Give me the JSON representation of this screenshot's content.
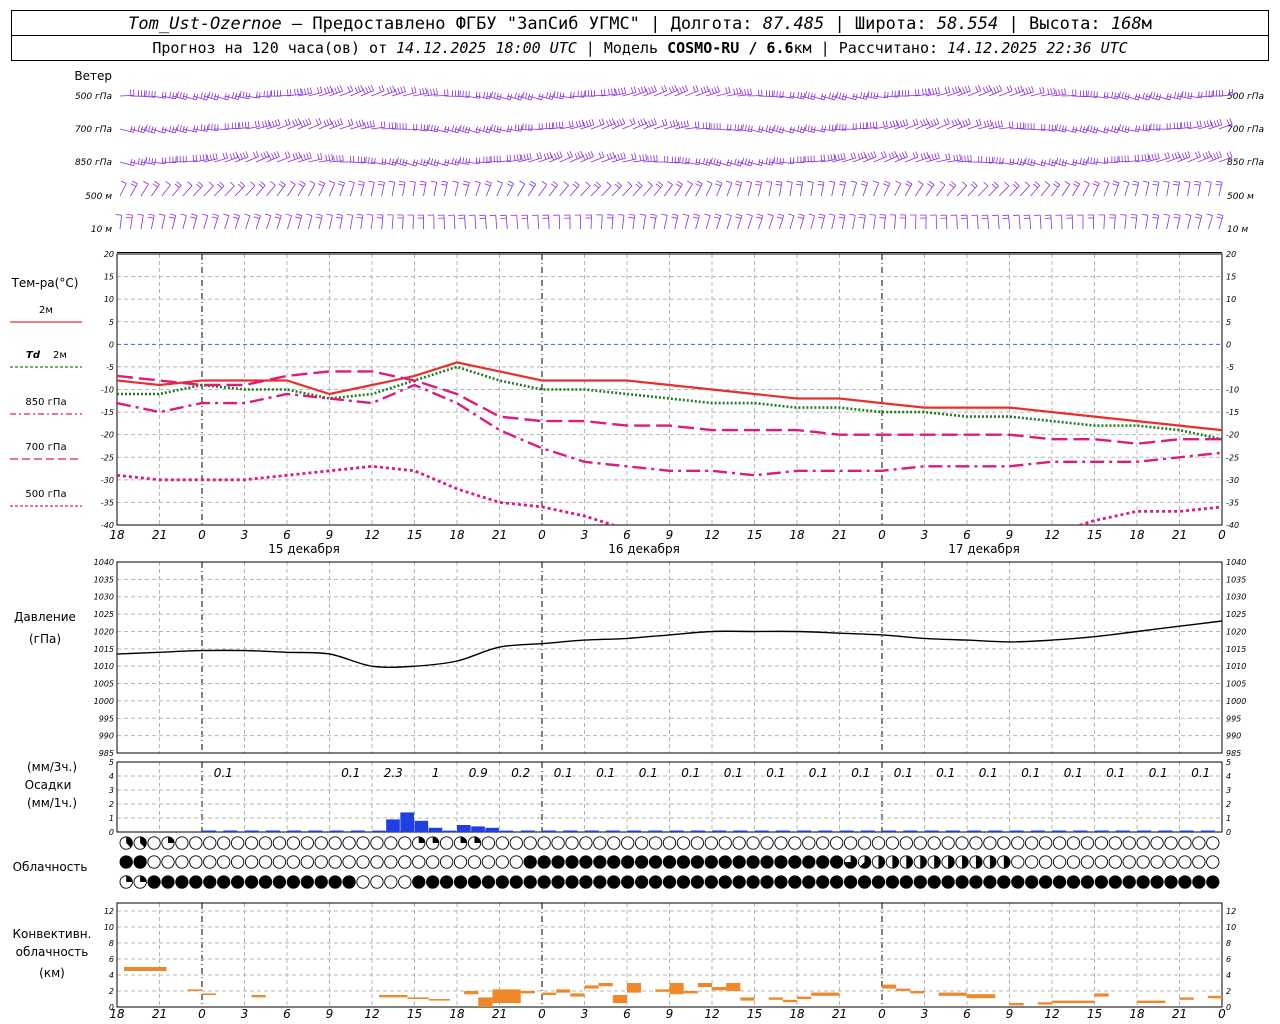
{
  "header": {
    "station": "Tom_Ust-Ozernoe",
    "provider": "Предоставлено ФГБУ \"ЗапСиб УГМС\"",
    "lon_label": "Долгота:",
    "lon": "87.485",
    "lat_label": "Широта:",
    "lat": "58.554",
    "alt_label": "Высота:",
    "alt": "168",
    "alt_unit": "м",
    "forecast_label": "Прогноз на 120 часа(ов) от",
    "forecast_from": "14.12.2025 18:00 UTC",
    "model_label": "Модель",
    "model": "COSMO-RU / 6.6",
    "model_unit": "км",
    "computed_label": "Рассчитано:",
    "computed": "14.12.2025 22:36 UTC"
  },
  "time_axis": {
    "hour_labels": [
      "18",
      "21",
      "0",
      "3",
      "6",
      "9",
      "12",
      "15",
      "18",
      "21",
      "0",
      "3",
      "6",
      "9",
      "12",
      "15",
      "18",
      "21",
      "0",
      "3",
      "6",
      "9",
      "12",
      "15",
      "18",
      "21",
      "0"
    ],
    "day_labels": [
      {
        "text": "15 декабря",
        "at_hour": 12
      },
      {
        "text": "16 декабря",
        "at_hour": 36
      },
      {
        "text": "17 декабря",
        "at_hour": 60
      }
    ],
    "midnights": [
      6,
      30,
      54,
      78
    ]
  },
  "wind_panel": {
    "title": "Ветер",
    "levels": [
      "500 гПа",
      "700 гПа",
      "850 гПа",
      "500 м",
      "10 м"
    ],
    "colors": {
      "barbs": "#8a2be2"
    }
  },
  "temp_panel": {
    "title": "Тем-ра(°С)",
    "legend": [
      {
        "label": "2м",
        "color": "#e8302a",
        "style": "solid"
      },
      {
        "label": "Td",
        "label2": "2м",
        "color": "#1e7d1e",
        "style": "dotted"
      },
      {
        "label": "850 гПа",
        "color": "#e0197d",
        "style": "dashdot"
      },
      {
        "label": "700 гПа",
        "color": "#e0197d",
        "style": "dash"
      },
      {
        "label": "500 гПа",
        "color": "#e0197d",
        "style": "dot"
      }
    ],
    "ticks": [
      "20",
      "15",
      "10",
      "5",
      "0",
      "-5",
      "-10",
      "-15",
      "-20",
      "-25",
      "-30",
      "-35",
      "-40"
    ]
  },
  "pressure_panel": {
    "title": "Давление",
    "unit": "(гПа)",
    "ticks": [
      "1040",
      "1035",
      "1030",
      "1025",
      "1020",
      "1015",
      "1010",
      "1005",
      "1000",
      "995",
      "990",
      "985"
    ]
  },
  "precip_panel": {
    "unit3h": "(мм/3ч.)",
    "title": "Осадки",
    "unit1h": "(мм/1ч.)",
    "ticks": [
      "5",
      "4",
      "3",
      "2",
      "1",
      "0"
    ],
    "amounts": [
      {
        "text": "0.1",
        "at_hour": 7.5
      },
      {
        "text": "0.1",
        "at_hour": 16.5
      },
      {
        "text": "2.3",
        "at_hour": 19.5
      },
      {
        "text": "1",
        "at_hour": 22.5
      },
      {
        "text": "0.9",
        "at_hour": 25.5
      },
      {
        "text": "0.2",
        "at_hour": 28.5
      },
      {
        "text": "0.1",
        "at_hour": 31.5
      },
      {
        "text": "0.1",
        "at_hour": 34.5
      },
      {
        "text": "0.1",
        "at_hour": 37.5
      },
      {
        "text": "0.1",
        "at_hour": 40.5
      },
      {
        "text": "0.1",
        "at_hour": 43.5
      },
      {
        "text": "0.1",
        "at_hour": 46.5
      },
      {
        "text": "0.1",
        "at_hour": 49.5
      },
      {
        "text": "0.1",
        "at_hour": 52.5
      },
      {
        "text": "0.1",
        "at_hour": 55.5
      },
      {
        "text": "0.1",
        "at_hour": 58.5
      },
      {
        "text": "0.1",
        "at_hour": 61.5
      },
      {
        "text": "0.1",
        "at_hour": 64.5
      },
      {
        "text": "0.1",
        "at_hour": 67.5
      },
      {
        "text": "0.1",
        "at_hour": 70.5
      },
      {
        "text": "0.1",
        "at_hour": 73.5
      },
      {
        "text": "0.1",
        "at_hour": 76.5
      }
    ],
    "colors": {
      "bars": "#1f3fe0"
    }
  },
  "cloud_panel": {
    "title": "Облачность",
    "rows": {
      "upper": "33302000200000000000008000000000220002200000000000000000000000000000000000000000000000000000000000000000000000000000000000",
      "middle": "88800000000000000000000000000000000000000000088888888888888888888888888888888888886544444444444444444000000000000000000000000",
      "lower": "222888888888888888888888888000000888888888888888888888888888888888888888888888888888888888888888888888888888888888888888888888"
    }
  },
  "conv_panel": {
    "title1": "Конвективн.",
    "title2": "облачность",
    "unit": "(км)",
    "ticks": [
      "12",
      "10",
      "8",
      "6",
      "4",
      "2",
      "0"
    ],
    "colors": {
      "bars": "#f0882a"
    }
  },
  "chart_data": [
    {
      "type": "line",
      "title": "Тем-ра(°С)",
      "x_unit": "hours since 14.12.2025 18:00 UTC",
      "ylim": [
        -40,
        20
      ],
      "series": [
        {
          "name": "2м",
          "x": [
            0,
            3,
            6,
            9,
            12,
            15,
            18,
            21,
            24,
            27,
            30,
            33,
            36,
            39,
            42,
            45,
            48,
            51,
            54,
            57,
            60,
            63,
            66,
            69,
            72,
            75,
            78
          ],
          "y": [
            -8,
            -9,
            -8,
            -8,
            -8,
            -11,
            -9,
            -7,
            -4,
            -6,
            -8,
            -8,
            -8,
            -9,
            -10,
            -11,
            -12,
            -12,
            -13,
            -14,
            -14,
            -14,
            -15,
            -16,
            -17,
            -18,
            -19
          ]
        },
        {
          "name": "Td 2м",
          "x": [
            0,
            3,
            6,
            9,
            12,
            15,
            18,
            21,
            24,
            27,
            30,
            33,
            36,
            39,
            42,
            45,
            48,
            51,
            54,
            57,
            60,
            63,
            66,
            69,
            72,
            75,
            78
          ],
          "y": [
            -11,
            -11,
            -9,
            -10,
            -10,
            -12,
            -11,
            -8,
            -5,
            -8,
            -10,
            -10,
            -11,
            -12,
            -13,
            -13,
            -14,
            -14,
            -15,
            -15,
            -16,
            -16,
            -17,
            -18,
            -18,
            -19,
            -21
          ]
        },
        {
          "name": "850 гПа",
          "x": [
            0,
            3,
            6,
            9,
            12,
            15,
            18,
            21,
            24,
            27,
            30,
            33,
            36,
            39,
            42,
            45,
            48,
            51,
            54,
            57,
            60,
            63,
            66,
            69,
            72,
            75,
            78
          ],
          "y": [
            -13,
            -15,
            -13,
            -13,
            -11,
            -12,
            -13,
            -9,
            -13,
            -19,
            -23,
            -26,
            -27,
            -28,
            -28,
            -29,
            -28,
            -28,
            -28,
            -27,
            -27,
            -27,
            -26,
            -26,
            -26,
            -25,
            -24
          ]
        },
        {
          "name": "700 гПа",
          "x": [
            0,
            3,
            6,
            9,
            12,
            15,
            18,
            21,
            24,
            27,
            30,
            33,
            36,
            39,
            42,
            45,
            48,
            51,
            54,
            57,
            60,
            63,
            66,
            69,
            72,
            75,
            78
          ],
          "y": [
            -7,
            -8,
            -9,
            -9,
            -7,
            -6,
            -6,
            -8,
            -11,
            -16,
            -17,
            -17,
            -18,
            -18,
            -19,
            -19,
            -19,
            -20,
            -20,
            -20,
            -20,
            -20,
            -21,
            -21,
            -22,
            -21,
            -21
          ]
        },
        {
          "name": "500 гПа",
          "x": [
            0,
            3,
            6,
            9,
            12,
            15,
            18,
            21,
            24,
            27,
            30,
            33,
            36,
            39,
            42,
            45,
            48,
            51,
            54,
            57,
            60,
            63,
            66,
            69,
            72,
            75,
            78
          ],
          "y": [
            -29,
            -30,
            -30,
            -30,
            -29,
            -28,
            -27,
            -28,
            -32,
            -35,
            -36,
            -38,
            -41,
            -43,
            -45,
            -46,
            -46,
            -46,
            -46,
            -46,
            -45,
            -44,
            -42,
            -39,
            -37,
            -37,
            -36
          ]
        }
      ]
    },
    {
      "type": "line",
      "title": "Давление",
      "ylabel": "(гПа)",
      "x_unit": "hours since 14.12.2025 18:00 UTC",
      "ylim": [
        985,
        1040
      ],
      "series": [
        {
          "name": "Давление",
          "x": [
            0,
            3,
            6,
            9,
            12,
            15,
            18,
            21,
            24,
            27,
            30,
            33,
            36,
            39,
            42,
            45,
            48,
            51,
            54,
            57,
            60,
            63,
            66,
            69,
            72,
            75,
            78
          ],
          "y": [
            1013.5,
            1014,
            1014.5,
            1014.5,
            1014,
            1013.5,
            1010,
            1010,
            1011.5,
            1015.5,
            1016.5,
            1017.5,
            1018,
            1019,
            1020,
            1020,
            1020,
            1019.5,
            1019,
            1018,
            1017.5,
            1017,
            1017.5,
            1018.5,
            1020,
            1021.5,
            1023
          ]
        }
      ]
    },
    {
      "type": "bar",
      "title": "Осадки",
      "ylabel": "(мм/1ч.)",
      "x_unit": "hours since 14.12.2025 18:00 UTC",
      "ylim": [
        0,
        5
      ],
      "x": [
        18,
        19,
        20,
        21,
        22,
        23,
        24,
        25,
        26,
        27
      ],
      "values": [
        0.1,
        0.9,
        1.4,
        0.8,
        0.3,
        0.1,
        0.5,
        0.4,
        0.3,
        0.1
      ]
    },
    {
      "type": "bar",
      "title": "Конвективн. облачность",
      "ylabel": "(км)",
      "x_unit": "hours since 14.12.2025 18:00 UTC",
      "ylim": [
        0,
        13
      ],
      "bars": [
        {
          "x0": 0.5,
          "x1": 3.5,
          "top": 5,
          "base": 4.5
        },
        {
          "x0": 5,
          "x1": 6,
          "top": 2.2,
          "base": 2
        },
        {
          "x0": 6,
          "x1": 7,
          "top": 1.7,
          "base": 1.5
        },
        {
          "x0": 9.5,
          "x1": 10.5,
          "top": 1.5,
          "base": 1.2
        },
        {
          "x0": 18.5,
          "x1": 20.5,
          "top": 1.5,
          "base": 1.2
        },
        {
          "x0": 20.5,
          "x1": 22,
          "top": 1.2,
          "base": 1
        },
        {
          "x0": 22,
          "x1": 23.5,
          "top": 1,
          "base": 0.8
        },
        {
          "x0": 24.5,
          "x1": 25.5,
          "top": 2,
          "base": 1.6
        },
        {
          "x0": 25.5,
          "x1": 26.5,
          "top": 1.2,
          "base": 0
        },
        {
          "x0": 26.5,
          "x1": 28.5,
          "top": 2.2,
          "base": 0.5
        },
        {
          "x0": 28.5,
          "x1": 29.5,
          "top": 2,
          "base": 1.7
        },
        {
          "x0": 30,
          "x1": 31,
          "top": 1.8,
          "base": 1.5
        },
        {
          "x0": 31,
          "x1": 32,
          "top": 2.2,
          "base": 1.8
        },
        {
          "x0": 32,
          "x1": 33,
          "top": 1.7,
          "base": 1.3
        },
        {
          "x0": 33,
          "x1": 34,
          "top": 2.7,
          "base": 2.3
        },
        {
          "x0": 34,
          "x1": 35,
          "top": 3,
          "base": 2.6
        },
        {
          "x0": 35,
          "x1": 36,
          "top": 1.5,
          "base": 0.5
        },
        {
          "x0": 36,
          "x1": 37,
          "top": 3,
          "base": 1.8
        },
        {
          "x0": 38,
          "x1": 39,
          "top": 2.2,
          "base": 1.9
        },
        {
          "x0": 39,
          "x1": 40,
          "top": 3,
          "base": 1.6
        },
        {
          "x0": 40,
          "x1": 41,
          "top": 2,
          "base": 1.7
        },
        {
          "x0": 41,
          "x1": 42,
          "top": 3,
          "base": 2.5
        },
        {
          "x0": 42,
          "x1": 43,
          "top": 2.5,
          "base": 2.1
        },
        {
          "x0": 43,
          "x1": 44,
          "top": 3,
          "base": 2
        },
        {
          "x0": 44,
          "x1": 45,
          "top": 1.2,
          "base": 0.8
        },
        {
          "x0": 46,
          "x1": 47,
          "top": 1.2,
          "base": 0.9
        },
        {
          "x0": 47,
          "x1": 48,
          "top": 0.9,
          "base": 0.6
        },
        {
          "x0": 48,
          "x1": 49,
          "top": 1.3,
          "base": 1
        },
        {
          "x0": 49,
          "x1": 51,
          "top": 1.8,
          "base": 1.4
        },
        {
          "x0": 54,
          "x1": 55,
          "top": 2.8,
          "base": 2.3
        },
        {
          "x0": 55,
          "x1": 56,
          "top": 2.3,
          "base": 2
        },
        {
          "x0": 56,
          "x1": 57,
          "top": 2,
          "base": 1.7
        },
        {
          "x0": 58,
          "x1": 60,
          "top": 1.8,
          "base": 1.4
        },
        {
          "x0": 60,
          "x1": 62,
          "top": 1.6,
          "base": 1.1
        },
        {
          "x0": 63,
          "x1": 64,
          "top": 0.5,
          "base": 0.2
        },
        {
          "x0": 65,
          "x1": 66,
          "top": 0.6,
          "base": 0.3
        },
        {
          "x0": 66,
          "x1": 69,
          "top": 0.8,
          "base": 0.5
        },
        {
          "x0": 69,
          "x1": 70,
          "top": 1.7,
          "base": 1.3
        },
        {
          "x0": 72,
          "x1": 74,
          "top": 0.8,
          "base": 0.5
        },
        {
          "x0": 75,
          "x1": 76,
          "top": 1.2,
          "base": 0.9
        },
        {
          "x0": 77,
          "x1": 78,
          "top": 1.4,
          "base": 1.1
        }
      ]
    }
  ]
}
